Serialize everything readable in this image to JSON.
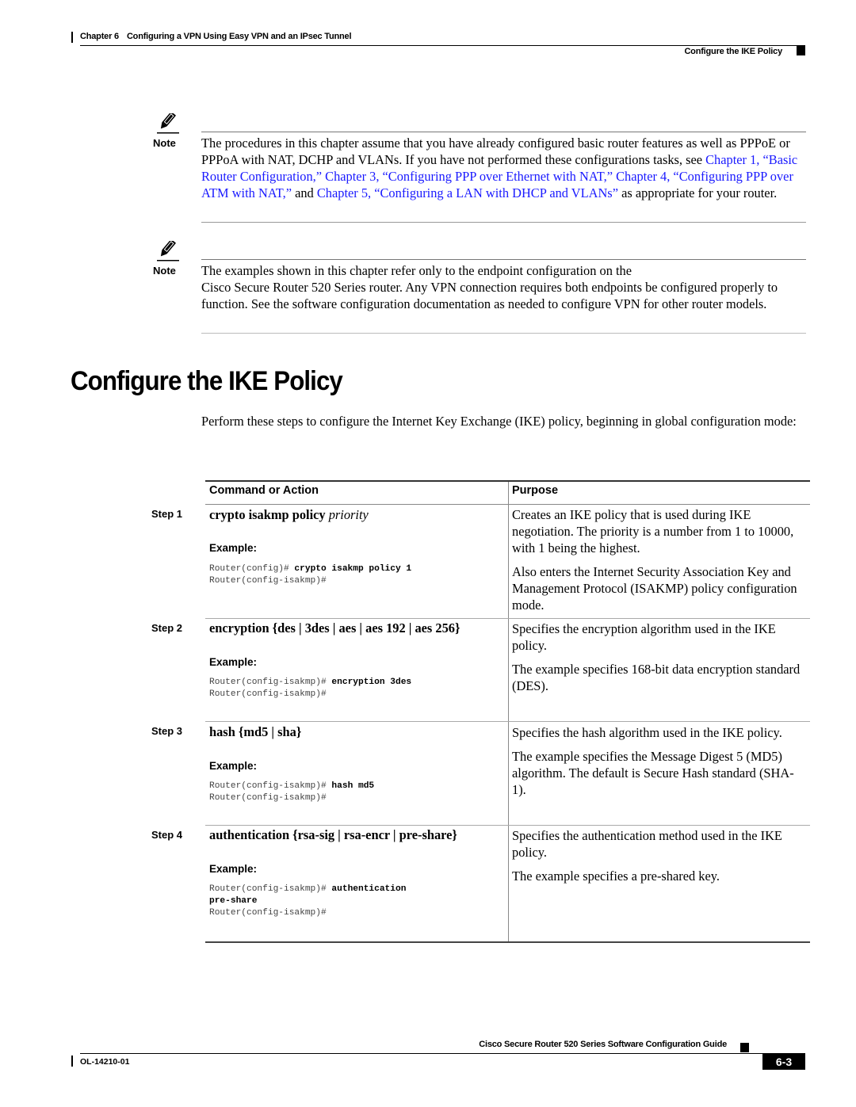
{
  "header": {
    "chapter": "Chapter 6",
    "chapter_title": "Configuring a VPN Using Easy VPN and an IPsec Tunnel",
    "section": "Configure the IKE Policy"
  },
  "notes": [
    {
      "label": "Note",
      "icon": "pencil-note-icon",
      "segments": [
        {
          "text": "The procedures in this chapter assume that you have already configured basic router features as well as PPPoE or PPPoA with NAT, DCHP and VLANs. If you have not performed these configurations tasks, see ",
          "link": false
        },
        {
          "text": "Chapter 1, “Basic Router Configuration,”",
          "link": true
        },
        {
          "text": " ",
          "link": false
        },
        {
          "text": "Chapter 3, “Configuring PPP over Ethernet with NAT,” Chapter 4, “Configuring PPP over ATM with NAT,”",
          "link": true
        },
        {
          "text": " and ",
          "link": false
        },
        {
          "text": "Chapter 5, “Configuring a LAN with DHCP and VLANs”",
          "link": true
        },
        {
          "text": " as appropriate for your router.",
          "link": false
        }
      ]
    },
    {
      "label": "Note",
      "icon": "pencil-note-icon",
      "line1": "The examples shown in this chapter refer only to the endpoint configuration on the",
      "rest": "Cisco Secure Router 520 Series router. Any VPN connection requires both endpoints be configured properly to function. See the software configuration documentation as needed to configure VPN for other router models."
    }
  ],
  "section": {
    "title": "Configure the IKE Policy",
    "intro": "Perform these steps to configure the Internet Key Exchange (IKE) policy, beginning in global configuration mode:"
  },
  "table": {
    "headers": {
      "command": "Command or Action",
      "purpose": "Purpose"
    },
    "example_label": "Example:",
    "steps": [
      {
        "step": "Step 1",
        "cmd_bold": "crypto isakmp policy",
        "cmd_italic": " priority",
        "code": [
          {
            "prompt": "Router(config)# ",
            "cmd": "crypto isakmp policy 1"
          },
          {
            "prompt": "Router(config-isakmp)#",
            "cmd": ""
          }
        ],
        "purpose": [
          "Creates an IKE policy that is used during IKE negotiation. The priority is a number from 1 to 10000, with 1 being the highest.",
          "Also enters the Internet Security Association Key and Management Protocol (ISAKMP) policy configuration mode."
        ]
      },
      {
        "step": "Step 2",
        "cmd_text": "encryption {des | 3des | aes | aes 192 | aes 256}",
        "code": [
          {
            "prompt": "Router(config-isakmp)# ",
            "cmd": "encryption 3des"
          },
          {
            "prompt": "Router(config-isakmp)#",
            "cmd": ""
          }
        ],
        "purpose": [
          "Specifies the encryption algorithm used in the IKE policy.",
          "The example specifies 168-bit data encryption standard (DES)."
        ]
      },
      {
        "step": "Step 3",
        "cmd_text": "hash {md5 | sha}",
        "code": [
          {
            "prompt": "Router(config-isakmp)# ",
            "cmd": "hash md5"
          },
          {
            "prompt": "Router(config-isakmp)#",
            "cmd": ""
          }
        ],
        "purpose": [
          "Specifies the hash algorithm used in the IKE policy.",
          "The example specifies the Message Digest 5 (MD5) algorithm. The default is Secure Hash standard (SHA-1)."
        ]
      },
      {
        "step": "Step 4",
        "cmd_text": "authentication {rsa-sig | rsa-encr | pre-share}",
        "code": [
          {
            "prompt": "Router(config-isakmp)# ",
            "cmd": "authentication"
          },
          {
            "prompt": "",
            "cmd": "pre-share"
          },
          {
            "prompt": "Router(config-isakmp)#",
            "cmd": ""
          }
        ],
        "purpose": [
          "Specifies the authentication method used in the IKE policy.",
          "The example specifies a pre-shared key."
        ]
      }
    ]
  },
  "footer": {
    "guide_title": "Cisco Secure Router 520 Series Software Configuration Guide",
    "doc_number": "OL-14210-01",
    "page": "6-3"
  }
}
